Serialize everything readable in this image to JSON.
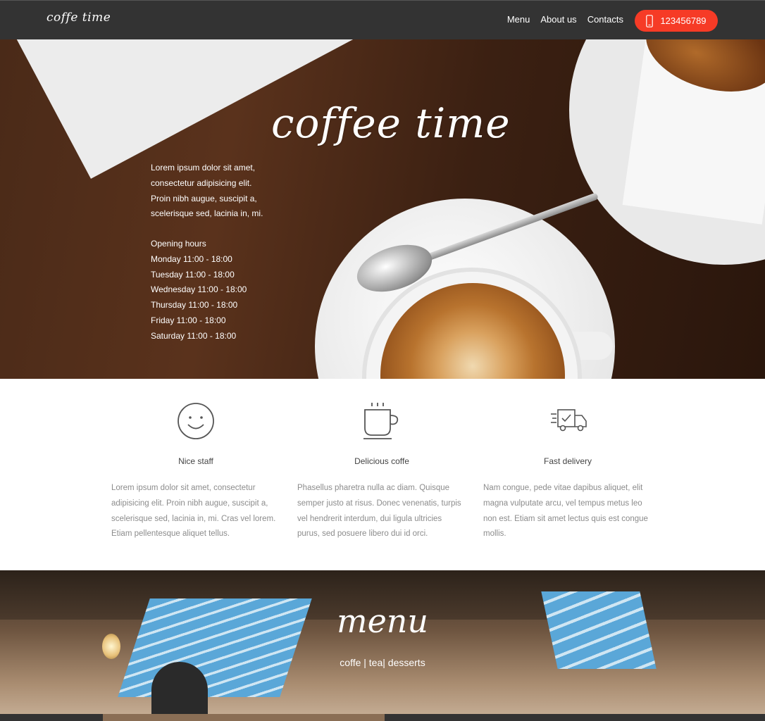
{
  "nav": {
    "logo": "coffe time",
    "links": [
      "Menu",
      "About us",
      "Contacts"
    ],
    "phone": "123456789",
    "phone_icon": "smartphone-icon",
    "accent": "#f63b26"
  },
  "hero": {
    "title": "coffee time",
    "intro": "Lorem ipsum dolor sit amet, consectetur adipisicing elit. Proin nibh augue, suscipit a, scelerisque sed, lacinia in, mi.",
    "hours_title": "Opening hours",
    "hours": [
      "Monday 11:00 - 18:00",
      "Tuesday 11:00 - 18:00",
      "Wednesday 11:00 - 18:00",
      "Thursday 11:00 - 18:00",
      "Friday 11:00 - 18:00",
      "Saturday 11:00 - 18:00"
    ]
  },
  "features": [
    {
      "icon": "smiley-icon",
      "title": "Nice staff",
      "text": "Lorem ipsum dolor sit amet, consectetur adipisicing elit. Proin nibh augue, suscipit a, scelerisque sed, lacinia in, mi. Cras vel lorem. Etiam pellentesque aliquet tellus."
    },
    {
      "icon": "coffee-cup-icon",
      "title": "Delicious coffe",
      "text": "Phasellus pharetra nulla ac diam. Quisque semper justo at risus. Donec venenatis, turpis vel hendrerit interdum, dui ligula ultricies purus, sed posuere libero dui id orci."
    },
    {
      "icon": "delivery-truck-icon",
      "title": "Fast delivery",
      "text": "Nam congue, pede vitae dapibus aliquet, elit magna vulputate arcu, vel tempus metus leo non est. Etiam sit amet lectus quis est congue mollis."
    }
  ],
  "menu": {
    "title": "menu",
    "categories": "coffe | tea| desserts"
  }
}
